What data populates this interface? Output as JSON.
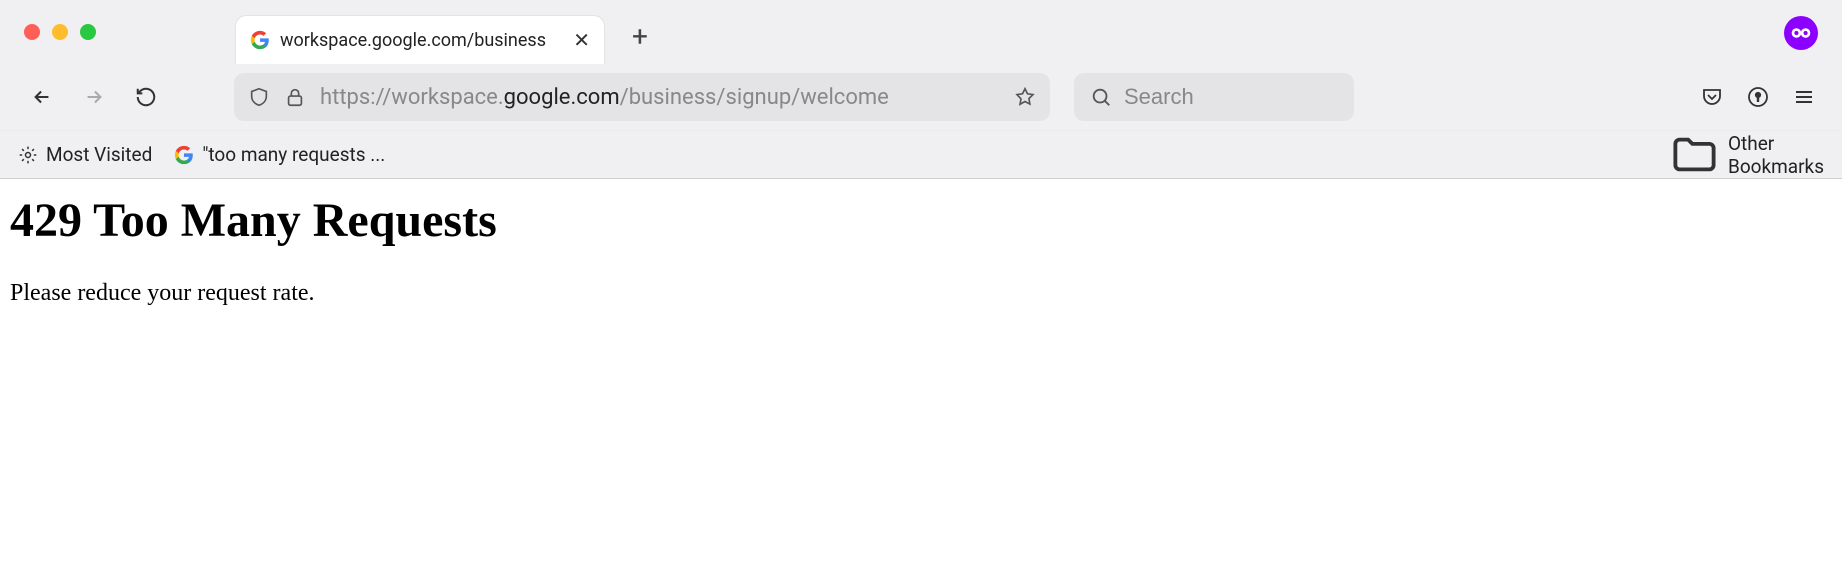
{
  "tab": {
    "title": "workspace.google.com/business"
  },
  "address": {
    "prefix": "https://workspace.",
    "domain": "google.com",
    "path": "/business/signup/welcome"
  },
  "search": {
    "placeholder": "Search"
  },
  "bookmarks": {
    "most_visited": "Most Visited",
    "item1": "\"too many requests ...",
    "other": "Other Bookmarks"
  },
  "page": {
    "heading": "429 Too Many Requests",
    "body": "Please reduce your request rate."
  }
}
